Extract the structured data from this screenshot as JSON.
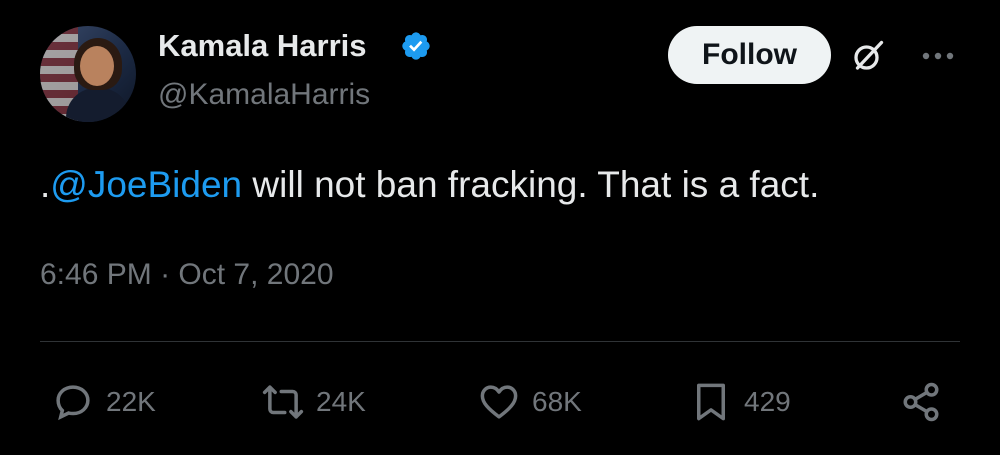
{
  "author": {
    "name": "Kamala Harris",
    "handle": "@KamalaHarris"
  },
  "header": {
    "follow_label": "Follow"
  },
  "tweet": {
    "prefix": ".",
    "mention": "@JoeBiden",
    "text": " will not ban fracking. That is a fact."
  },
  "timestamp": {
    "time": "6:46 PM",
    "separator": " · ",
    "date": "Oct 7, 2020"
  },
  "actions": {
    "replies": "22K",
    "reposts": "24K",
    "likes": "68K",
    "bookmarks": "429"
  },
  "colors": {
    "background": "#000000",
    "primary_text": "#e7e9ea",
    "secondary_text": "#71767b",
    "accent": "#1d9bf0",
    "follow_button": "#eff3f4"
  },
  "icons": [
    "verified-badge-icon",
    "grok-icon",
    "more-icon",
    "reply-icon",
    "repost-icon",
    "like-icon",
    "bookmark-icon",
    "share-icon"
  ]
}
